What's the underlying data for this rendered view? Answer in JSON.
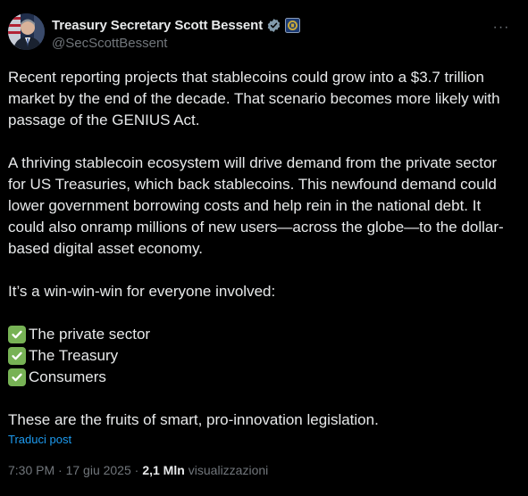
{
  "author": {
    "display_name": "Treasury Secretary Scott Bessent",
    "handle": "@SecScottBessent",
    "verified_icon": "verified-badge-icon",
    "affiliation_icon": "treasury-seal-icon"
  },
  "menu": {
    "more_icon": "more-horizontal-icon",
    "more_label": "···"
  },
  "post": {
    "p1": "Recent reporting projects that stablecoins could grow into a $3.7 trillion market by the end of the decade. That scenario becomes more likely with passage of the GENIUS Act.",
    "p2": "A thriving stablecoin ecosystem will drive demand from the private sector for US Treasuries, which back stablecoins. This newfound demand could lower government borrowing costs and help rein in the national debt. It could also onramp millions of new users—across the globe—to the dollar-based digital asset economy.",
    "p3": "It’s a win-win-win for everyone involved:",
    "checks": [
      "The private sector",
      " The Treasury",
      " Consumers"
    ],
    "p4": "These are the fruits of smart, pro-innovation legislation."
  },
  "translate_label": "Traduci post",
  "meta": {
    "timestamp": "7:30 PM · 17 giu 2025 ·",
    "views_count": "2,1 Mln",
    "views_label": "visualizzazioni"
  },
  "colors": {
    "background": "#000000",
    "text": "#e7e9ea",
    "muted": "#71767b",
    "link": "#1d9bf0",
    "verified": "#829aab",
    "check": "#77b255"
  }
}
